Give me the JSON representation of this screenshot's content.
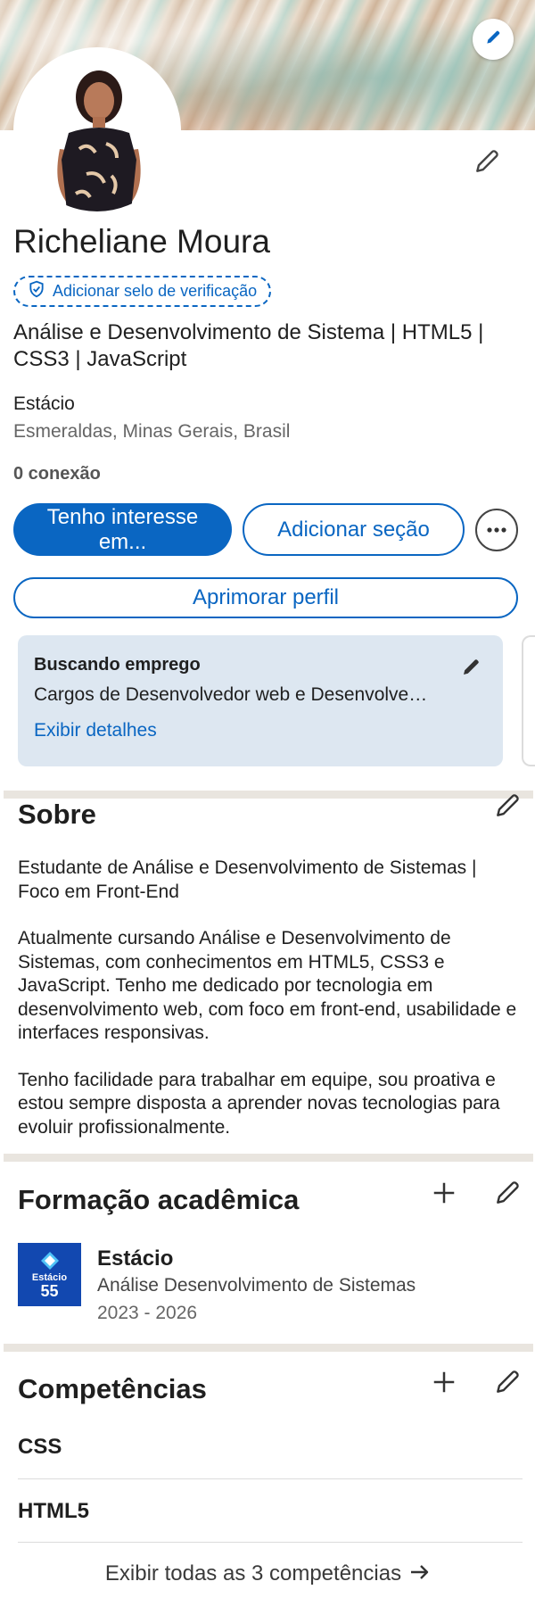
{
  "profile": {
    "name": "Richeliane Moura",
    "verification_label": "Adicionar selo de verificação",
    "headline": "Análise e Desenvolvimento de Sistema | HTML5 | CSS3 | JavaScript",
    "company": "Estácio",
    "location": "Esmeraldas, Minas Gerais, Brasil",
    "connections": "0 conexão"
  },
  "actions": {
    "primary_label": "Tenho interesse em...",
    "secondary_label": "Adicionar seção",
    "improve_label": "Aprimorar perfil"
  },
  "open_to_work": {
    "title": "Buscando emprego",
    "description": "Cargos de Desenvolvedor web e Desenvolve…",
    "link_label": "Exibir detalhes"
  },
  "about": {
    "title": "Sobre",
    "paragraphs": [
      "Estudante de Análise e Desenvolvimento de Sistemas | Foco em Front-End",
      "Atualmente cursando Análise e Desenvolvimento de Sistemas, com conhecimentos em HTML5, CSS3 e JavaScript. Tenho me dedicado por tecnologia em desenvolvimento web, com foco em front-end, usabilidade e interfaces responsivas.",
      "Tenho facilidade para trabalhar em equipe, sou proativa e estou sempre disposta a aprender novas tecnologias para evoluir profissionalmente."
    ]
  },
  "education": {
    "title": "Formação acadêmica",
    "items": [
      {
        "school": "Estácio",
        "logo_text": "Estácio",
        "logo_number": "55",
        "degree": "Análise Desenvolvimento de Sistemas",
        "years": "2023 - 2026"
      }
    ]
  },
  "skills": {
    "title": "Competências",
    "items": [
      "CSS",
      "HTML5"
    ],
    "show_all_label": "Exibir todas as 3 competências"
  },
  "colors": {
    "accent": "#0a66c2",
    "card_bg": "#dde7f1",
    "divider": "#e9e5df"
  },
  "icons": {
    "edit": "pencil-icon",
    "add": "plus-icon",
    "more": "ellipsis-icon",
    "verify": "shield-check-icon",
    "arrow": "arrow-right-icon"
  }
}
